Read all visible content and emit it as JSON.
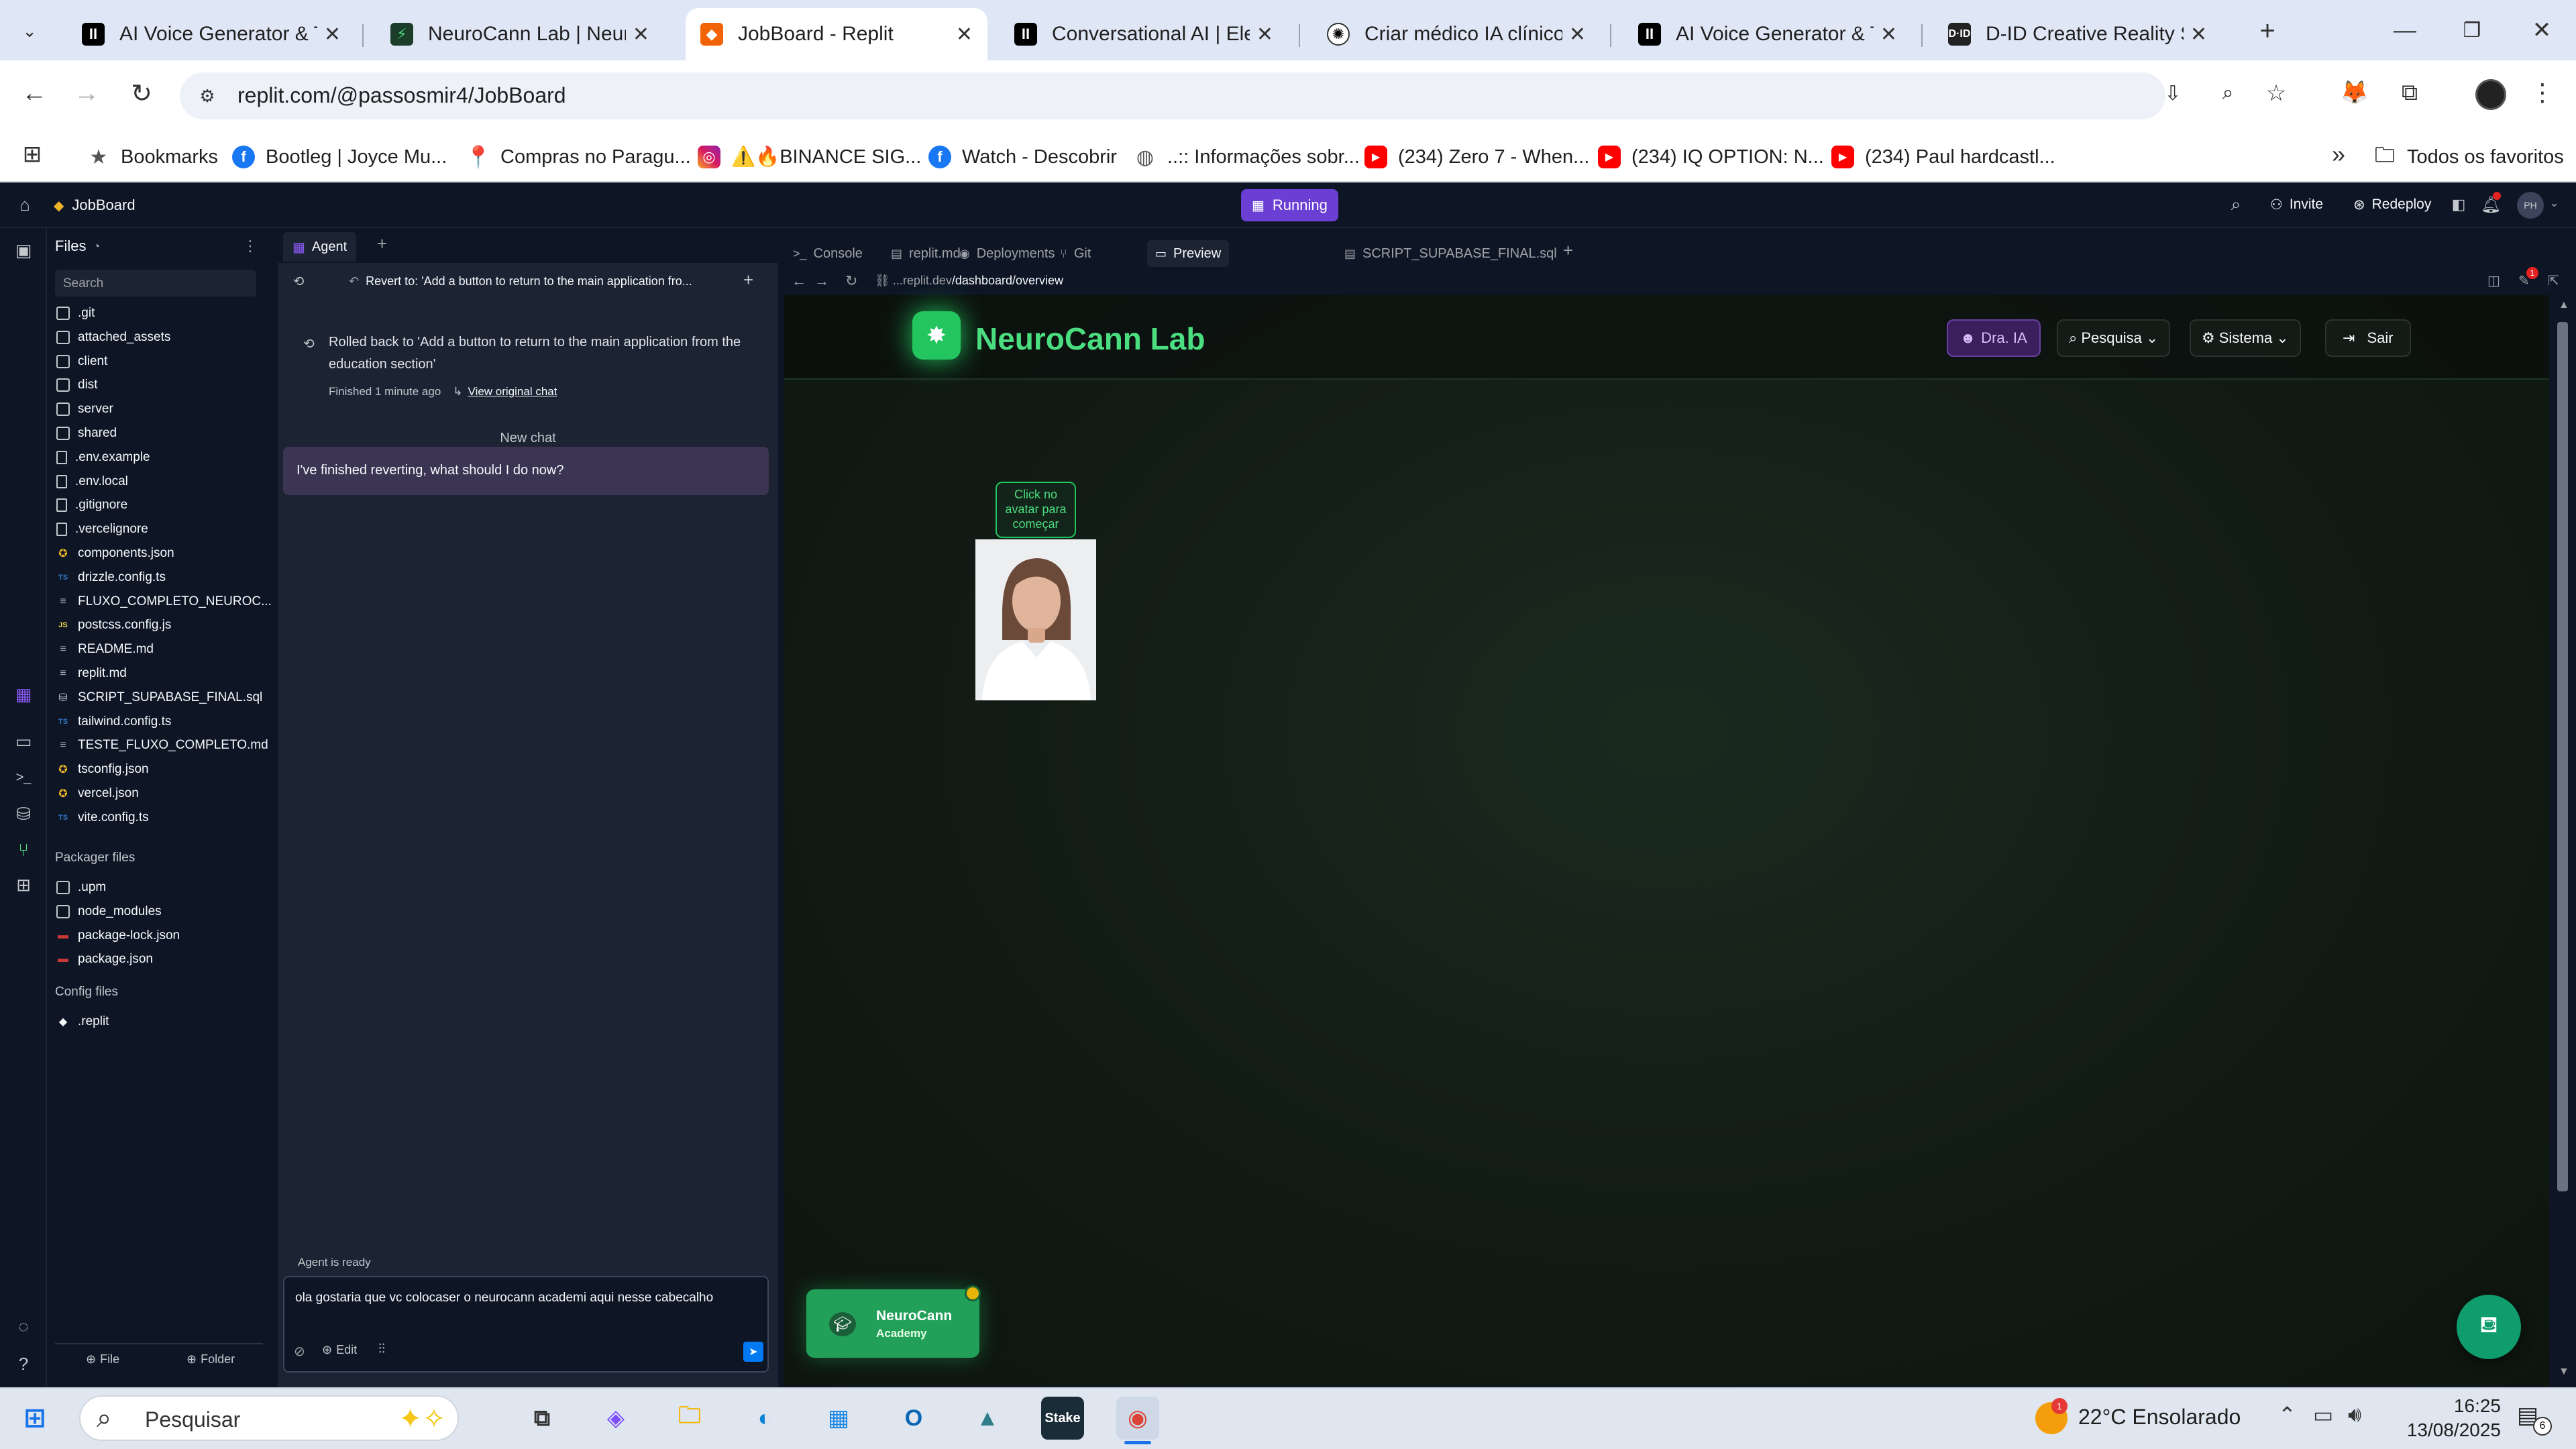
{
  "browser": {
    "tabs": [
      {
        "title": "AI Voice Generator & Text",
        "icon": "elevenlabs-icon"
      },
      {
        "title": "NeuroCann Lab | NeuroCa",
        "icon": "neurocann-icon"
      },
      {
        "title": "JobBoard - Replit",
        "icon": "replit-icon"
      },
      {
        "title": "Conversational AI | Eleven",
        "icon": "elevenlabs-icon"
      },
      {
        "title": "Criar médico IA clínico",
        "icon": "openai-icon"
      },
      {
        "title": "AI Voice Generator & Text",
        "icon": "elevenlabs-icon"
      },
      {
        "title": "D-ID Creative Reality Stud",
        "icon": "did-icon"
      }
    ],
    "url": "replit.com/@passosmir4/JobBoard",
    "bookmarks": [
      {
        "label": "Bookmarks",
        "icon": "star-icon"
      },
      {
        "label": "Bootleg | Joyce Mu...",
        "icon": "facebook-icon"
      },
      {
        "label": "Compras no Paragu...",
        "icon": "pin-icon"
      },
      {
        "label": "⚠️🔥BINANCE SIG...",
        "icon": "instagram-icon"
      },
      {
        "label": "Watch - Descobrir",
        "icon": "facebook-icon"
      },
      {
        "label": "..:: Informações sobr...",
        "icon": "globe-icon"
      },
      {
        "label": "(234) Zero 7 - When...",
        "icon": "youtube-icon"
      },
      {
        "label": "(234) IQ OPTION: N...",
        "icon": "youtube-icon"
      },
      {
        "label": "(234) Paul hardcastl...",
        "icon": "youtube-icon"
      }
    ],
    "all_bookmarks": "Todos os favoritos"
  },
  "replit": {
    "project": "JobBoard",
    "status": "Running",
    "invite": "Invite",
    "redeploy": "Redeploy",
    "avatar": "PH",
    "files_title": "Files",
    "search_placeholder": "Search",
    "files": [
      {
        "name": ".git",
        "type": "folder"
      },
      {
        "name": "attached_assets",
        "type": "folder"
      },
      {
        "name": "client",
        "type": "folder"
      },
      {
        "name": "dist",
        "type": "folder"
      },
      {
        "name": "server",
        "type": "folder"
      },
      {
        "name": "shared",
        "type": "folder"
      },
      {
        "name": ".env.example",
        "type": "doc"
      },
      {
        "name": ".env.local",
        "type": "doc"
      },
      {
        "name": ".gitignore",
        "type": "doc"
      },
      {
        "name": ".vercelignore",
        "type": "doc"
      },
      {
        "name": "components.json",
        "type": "json"
      },
      {
        "name": "drizzle.config.ts",
        "type": "ts"
      },
      {
        "name": "FLUXO_COMPLETO_NEUROC...",
        "type": "md"
      },
      {
        "name": "postcss.config.js",
        "type": "js"
      },
      {
        "name": "README.md",
        "type": "md"
      },
      {
        "name": "replit.md",
        "type": "md"
      },
      {
        "name": "SCRIPT_SUPABASE_FINAL.sql",
        "type": "sql"
      },
      {
        "name": "tailwind.config.ts",
        "type": "ts"
      },
      {
        "name": "TESTE_FLUXO_COMPLETO.md",
        "type": "md"
      },
      {
        "name": "tsconfig.json",
        "type": "json"
      },
      {
        "name": "vercel.json",
        "type": "json"
      },
      {
        "name": "vite.config.ts",
        "type": "ts"
      }
    ],
    "packager_title": "Packager files",
    "packager_files": [
      {
        "name": ".upm",
        "type": "folder"
      },
      {
        "name": "node_modules",
        "type": "folder"
      },
      {
        "name": "package-lock.json",
        "type": "npm"
      },
      {
        "name": "package.json",
        "type": "npm"
      }
    ],
    "config_title": "Config files",
    "config_files": [
      {
        "name": ".replit",
        "type": "replit"
      }
    ],
    "bottom_file": "File",
    "bottom_folder": "Folder"
  },
  "agent": {
    "tab": "Agent",
    "revert_text": "Revert to: 'Add a button to return to the main application fro...",
    "rolled_back": "Rolled back to 'Add a button to return to the main application from the education section'",
    "finished": "Finished 1 minute ago",
    "view_original": "View original chat",
    "new_chat": "New chat",
    "message": "I've finished reverting, what should I do now?",
    "ready": "Agent is ready",
    "input_text": "ola gostaria que vc colocaser o neurocann academi  aqui nesse cabecalho",
    "edit": "Edit"
  },
  "preview_tabs": [
    {
      "label": "Console",
      "icon": ">_"
    },
    {
      "label": "replit.md",
      "icon": "▤"
    },
    {
      "label": "Deployments",
      "icon": "◉"
    },
    {
      "label": "Git",
      "icon": "⑂"
    },
    {
      "label": "Preview",
      "icon": "▭"
    },
    {
      "label": "SCRIPT_SUPABASE_FINAL.sql",
      "icon": "▤"
    }
  ],
  "preview_url_prefix": "...replit.dev",
  "preview_url_path": "/dashboard/overview",
  "site": {
    "brand": "NeuroCann Lab",
    "dra": "Dra. IA",
    "pesquisa": "Pesquisa",
    "sistema": "Sistema",
    "sair": "Sair",
    "avatar_hint": "Click no avatar para começar",
    "academy_line1": "NeuroCann",
    "academy_line2": "Academy"
  },
  "taskbar": {
    "search": "Pesquisar",
    "weather": "22°C  Ensolarado",
    "time": "16:25",
    "date": "13/08/2025",
    "notif_count": "6",
    "weather_badge": "1"
  },
  "colors": {
    "accent": "#4ade80",
    "replit_orange": "#f26207",
    "running": "#7c3aed"
  }
}
